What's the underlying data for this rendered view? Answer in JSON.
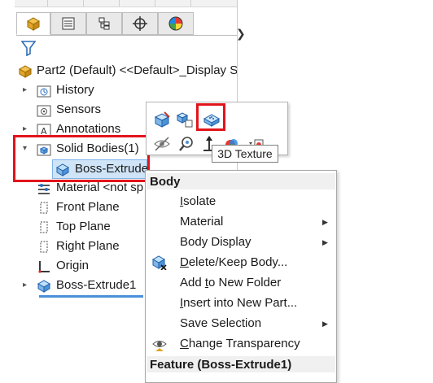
{
  "tree": {
    "part_title": "Part2 (Default) <<Default>_Display S",
    "items": [
      {
        "label": "History"
      },
      {
        "label": "Sensors"
      },
      {
        "label": "Annotations"
      },
      {
        "label": "Solid Bodies(1)"
      },
      {
        "label": "Boss-Extrude"
      },
      {
        "label": "Material <not sp"
      },
      {
        "label": "Front Plane"
      },
      {
        "label": "Top Plane"
      },
      {
        "label": "Right Plane"
      },
      {
        "label": "Origin"
      },
      {
        "label": "Boss-Extrude1"
      }
    ]
  },
  "tooltip": {
    "text": "3D Texture"
  },
  "menu": {
    "header": "Body",
    "items": [
      {
        "pre": "",
        "u": "I",
        "post": "solate",
        "submenu": false
      },
      {
        "pre": "",
        "u": "",
        "post": "Material",
        "submenu": true
      },
      {
        "pre": "Body Display",
        "u": "",
        "post": "",
        "submenu": true
      },
      {
        "pre": "",
        "u": "D",
        "post": "elete/Keep Body...",
        "submenu": false
      },
      {
        "pre": "Add ",
        "u": "t",
        "post": "o New Folder",
        "submenu": false
      },
      {
        "pre": "",
        "u": "I",
        "post": "nsert into New Part...",
        "submenu": false
      },
      {
        "pre": "Save Selection",
        "u": "",
        "post": "",
        "submenu": true
      },
      {
        "pre": "",
        "u": "C",
        "post": "hange Transparency",
        "submenu": false
      }
    ],
    "footer": "Feature (Boss-Extrude1)"
  },
  "colors": {
    "highlight_red": "#e2141b",
    "selection_blue": "#cfe4f7",
    "accent_blue": "#4a90d9"
  }
}
